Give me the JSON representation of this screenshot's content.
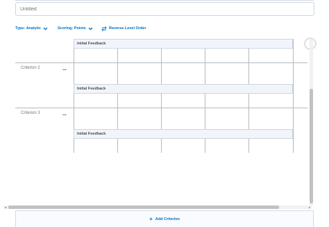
{
  "title_input": {
    "value": "Untitled"
  },
  "toolbar": {
    "type_label": "Type: Analytic",
    "scoring_label": "Scoring: Points",
    "reverse_label": "Reverse Level Order"
  },
  "criteria": [
    {
      "label": "",
      "feedback_label": "Initial Feedback"
    },
    {
      "label": "Criterion 2",
      "feedback_label": "Initial Feedback"
    },
    {
      "label": "Criterion 3",
      "feedback_label": "Initial Feedback"
    }
  ],
  "more_options": "...",
  "slash": "/",
  "add_criterion": {
    "label": "Add Criterion",
    "icon": "plus-icon"
  },
  "colors": {
    "accent": "#006fbf",
    "feedback_bg": "#f1f5fb",
    "grid": "#b4b9bf"
  }
}
